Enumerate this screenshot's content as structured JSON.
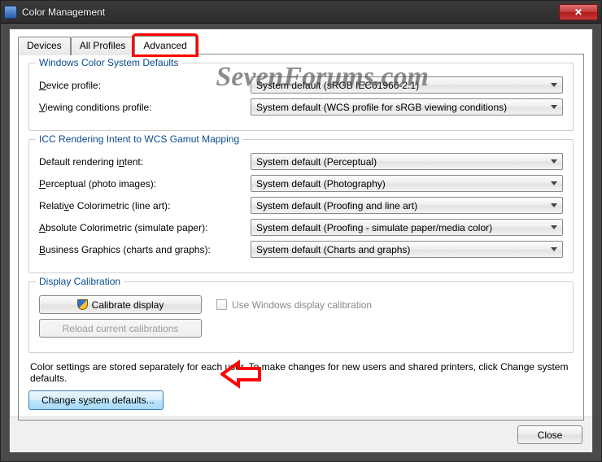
{
  "window": {
    "title": "Color Management",
    "close_glyph": "✕"
  },
  "watermark": "SevenForums.com",
  "tabs": {
    "devices": "Devices",
    "all_profiles": "All Profiles",
    "advanced": "Advanced"
  },
  "group_wcs": {
    "legend": "Windows Color System Defaults",
    "device_profile_label_pre": "D",
    "device_profile_label_post": "evice profile:",
    "device_profile_value": "System default (sRGB IEC61966-2.1)",
    "viewing_label_pre": "V",
    "viewing_label_post": "iewing conditions profile:",
    "viewing_value": "System default (WCS profile for sRGB viewing conditions)"
  },
  "group_icc": {
    "legend": "ICC Rendering Intent to WCS Gamut Mapping",
    "default_label_pre": "Default rendering i",
    "default_label_ul": "n",
    "default_label_post": "tent:",
    "default_value": "System default (Perceptual)",
    "perc_label_pre": "P",
    "perc_label_post": "erceptual (photo images):",
    "perc_value": "System default (Photography)",
    "rel_label_pre": "Relati",
    "rel_label_ul": "v",
    "rel_label_post": "e Colorimetric (line art):",
    "rel_value": "System default (Proofing and line art)",
    "abs_label_pre": "A",
    "abs_label_post": "bsolute Colorimetric (simulate paper):",
    "abs_value": "System default (Proofing - simulate paper/media color)",
    "biz_label_pre": "B",
    "biz_label_post": "usiness Graphics (charts and graphs):",
    "biz_value": "System default (Charts and graphs)"
  },
  "group_calib": {
    "legend": "Display Calibration",
    "calibrate_pre": "C",
    "calibrate_post": "alibrate display",
    "reload_pre": "R",
    "reload_post": "eload current calibrations",
    "use_win_pre": "U",
    "use_win_post": "se Windows display calibration"
  },
  "note_text": "Color settings are stored separately for each user. To make changes for new users and shared printers, click Change system defaults.",
  "change_defaults_pre": "Change s",
  "change_defaults_ul": "y",
  "change_defaults_post": "stem defaults...",
  "footer": {
    "close": "Close"
  }
}
